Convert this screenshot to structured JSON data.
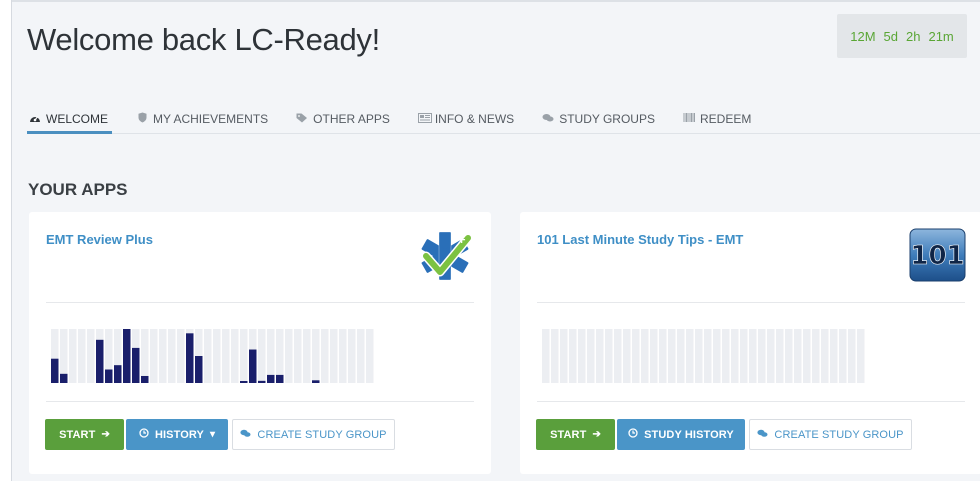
{
  "header": {
    "title": "Welcome back LC-Ready!",
    "countdown": [
      "12M",
      "5d",
      "2h",
      "21m"
    ]
  },
  "tabs": [
    {
      "label": "WELCOME",
      "icon": "dashboard-icon",
      "active": true
    },
    {
      "label": "MY ACHIEVEMENTS",
      "icon": "shield-icon",
      "active": false
    },
    {
      "label": "OTHER APPS",
      "icon": "tags-icon",
      "active": false
    },
    {
      "label": "INFO & NEWS",
      "icon": "newspaper-icon",
      "active": false
    },
    {
      "label": "STUDY GROUPS",
      "icon": "comments-icon",
      "active": false
    },
    {
      "label": "REDEEM",
      "icon": "barcode-icon",
      "active": false
    }
  ],
  "section_title": "YOUR APPS",
  "apps": [
    {
      "title": "EMT Review Plus",
      "logo": "star-of-life-checkmark-logo",
      "activity": [
        0.45,
        0.17,
        0,
        0,
        0,
        0.8,
        0.25,
        0.33,
        1.0,
        0.65,
        0.13,
        0,
        0,
        0,
        0,
        0.92,
        0.5,
        0,
        0,
        0,
        0,
        0.02,
        0.62,
        0.04,
        0.15,
        0.15,
        0,
        0,
        0,
        0.05,
        0,
        0,
        0,
        0,
        0,
        0
      ],
      "buttons": {
        "start": "START",
        "history": "HISTORY",
        "create": "CREATE STUDY GROUP"
      }
    },
    {
      "title": "101 Last Minute Study Tips - EMT",
      "logo": "101-logo",
      "logo_text": "101",
      "activity": [
        0,
        0,
        0,
        0,
        0,
        0,
        0,
        0,
        0,
        0,
        0,
        0,
        0,
        0,
        0,
        0,
        0,
        0,
        0,
        0,
        0,
        0,
        0,
        0,
        0,
        0,
        0,
        0,
        0,
        0,
        0,
        0,
        0,
        0,
        0,
        0
      ],
      "buttons": {
        "start": "START",
        "history": "STUDY HISTORY",
        "create": "CREATE STUDY GROUP"
      }
    }
  ],
  "colors": {
    "accent": "#4a8fc0",
    "start": "#5a9f3c",
    "bar": "#1a1f6b",
    "bar_bg": "#eceef2",
    "countdown": "#5aa635"
  }
}
